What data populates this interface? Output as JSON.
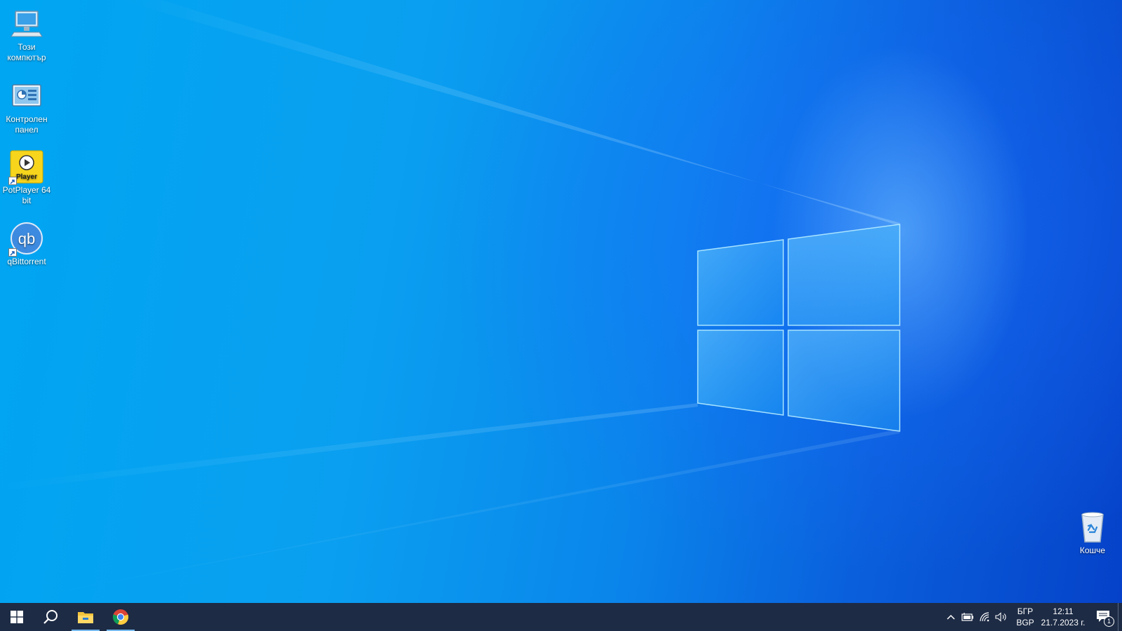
{
  "desktop": {
    "icons": [
      {
        "label": "Този компютър",
        "icon": "this-pc-icon"
      },
      {
        "label": "Контролен панел",
        "icon": "control-panel-icon"
      },
      {
        "label": "PotPlayer 64 bit",
        "icon": "potplayer-icon",
        "badge": "Player"
      },
      {
        "label": "qBittorrent",
        "icon": "qbittorrent-icon",
        "badge": "qb"
      }
    ],
    "recycle_bin": {
      "label": "Кошче",
      "icon": "recycle-bin-icon"
    }
  },
  "taskbar": {
    "start": {
      "icon": "windows-start-icon"
    },
    "search": {
      "icon": "search-icon"
    },
    "pinned": [
      {
        "name": "File Explorer",
        "icon": "file-explorer-icon",
        "active": true
      },
      {
        "name": "Google Chrome",
        "icon": "chrome-icon",
        "active": true
      }
    ],
    "tray": {
      "chevron_icon": "chevron-up-icon",
      "battery_icon": "battery-icon",
      "network_icon": "wifi-icon",
      "volume_icon": "volume-icon",
      "language": {
        "line1": "БГР",
        "line2": "BGP"
      },
      "clock": {
        "time": "12:11",
        "date": "21.7.2023 г."
      },
      "notifications": {
        "icon": "notifications-icon",
        "count": "1"
      }
    }
  },
  "colors": {
    "wallpaper_light": "#00a6f2",
    "wallpaper_dark": "#0542c9",
    "taskbar": "#1d2b45",
    "active_indicator": "#76b9ed"
  }
}
